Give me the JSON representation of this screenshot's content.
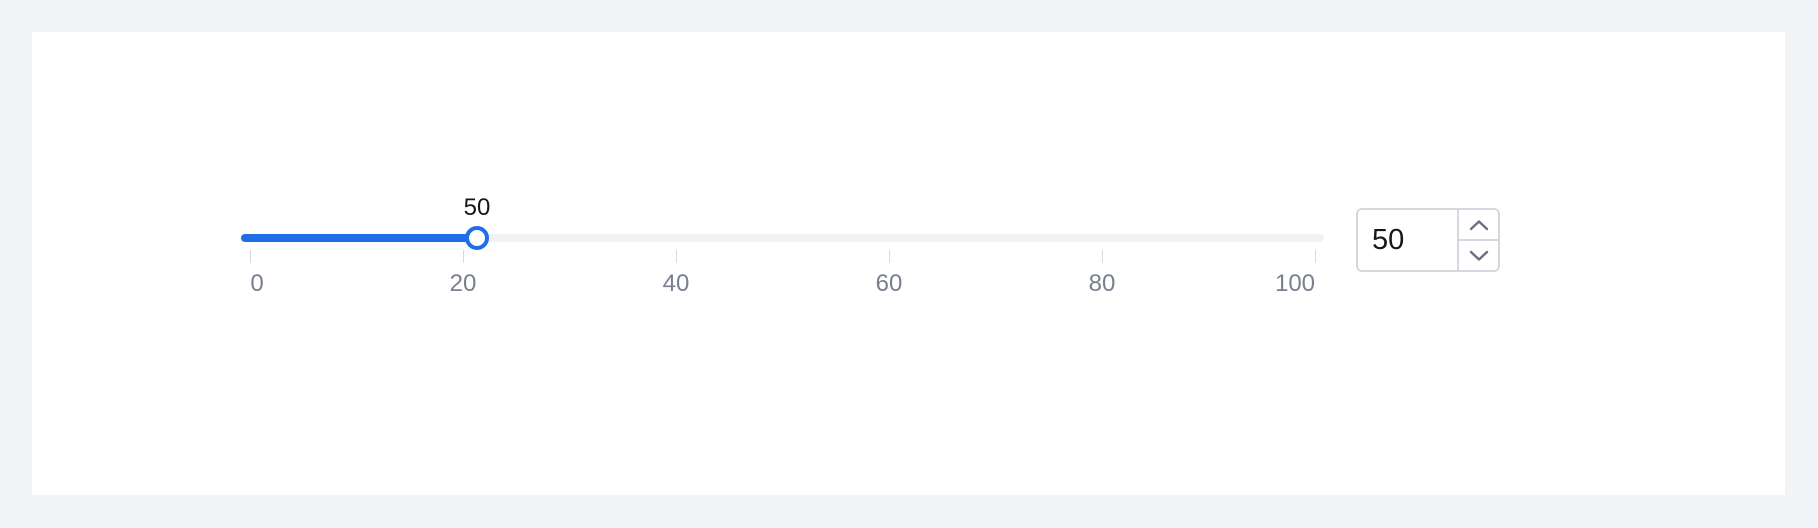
{
  "slider": {
    "min": 0,
    "max": 100,
    "value": 50,
    "tooltip": "50",
    "accent_color": "#1f6ee8",
    "track_color": "#f1f2f6",
    "marks": [
      "0",
      "20",
      "40",
      "60",
      "80",
      "100"
    ]
  },
  "number_input": {
    "value": "50",
    "increment_icon": "chevron-up-icon",
    "decrement_icon": "chevron-down-icon"
  }
}
